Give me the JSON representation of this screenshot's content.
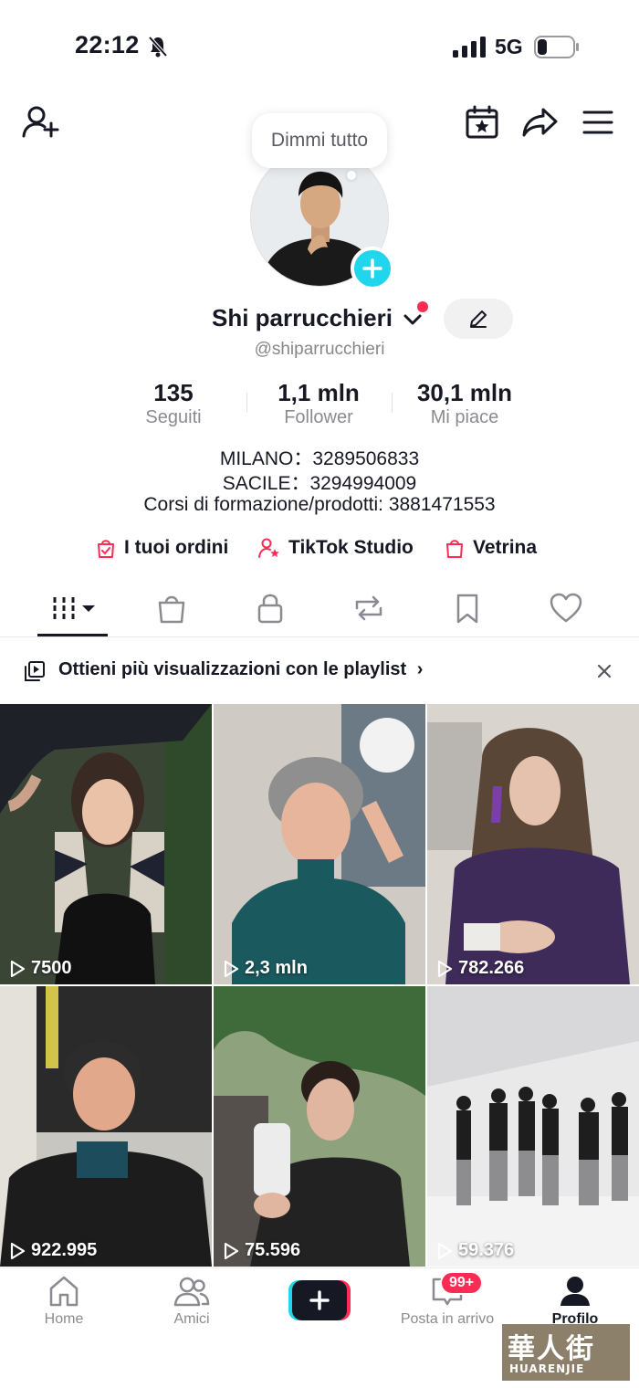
{
  "status_bar": {
    "time": "22:12",
    "network": "5G"
  },
  "profile": {
    "bubble_text": "Dimmi tutto",
    "name": "Shi parrucchieri",
    "handle": "@shiparrucchieri",
    "stats": [
      {
        "value": "135",
        "label": "Seguiti"
      },
      {
        "value": "1,1 mln",
        "label": "Follower"
      },
      {
        "value": "30,1 mln",
        "label": "Mi piace"
      }
    ],
    "bio": [
      "MILANO：3289506833",
      "SACILE：3294994009",
      "Corsi di formazione/prodotti: 3881471553"
    ],
    "links": [
      {
        "label": "I tuoi ordini",
        "icon": "bag-check-icon"
      },
      {
        "label": "TikTok Studio",
        "icon": "person-star-icon"
      },
      {
        "label": "Vetrina",
        "icon": "shopping-bag-icon"
      }
    ]
  },
  "tabs": [
    "videos-grid-icon",
    "shop-bag-icon",
    "lock-icon",
    "repost-icon",
    "bookmark-icon",
    "heart-icon"
  ],
  "playlist_banner": {
    "text": "Ottieni più visualizzazioni con le playlist",
    "arrow": "›"
  },
  "videos": [
    {
      "views": "7500"
    },
    {
      "views": "2,3 mln"
    },
    {
      "views": "782.266"
    },
    {
      "views": "922.995"
    },
    {
      "views": "75.596"
    },
    {
      "views": "59.376"
    }
  ],
  "bottom_nav": {
    "items": [
      {
        "label": "Home"
      },
      {
        "label": "Amici"
      },
      {
        "label": ""
      },
      {
        "label": "Posta in arrivo"
      },
      {
        "label": "Profilo"
      }
    ],
    "inbox_badge": "99+"
  },
  "watermark": {
    "line1": "華人街",
    "line2": "HUARENJIE"
  },
  "colors": {
    "accent": "#fe2c55",
    "cyan": "#20d5ec",
    "text": "#161823",
    "secondary": "#8a8b91"
  }
}
